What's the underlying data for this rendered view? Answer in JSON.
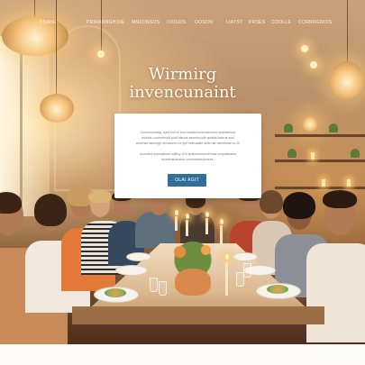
{
  "nav": {
    "items": [
      "CSANE",
      "PRIRANNGHOIE",
      "MNZONSOS",
      "CIOUDS",
      "OOSON",
      "LIATST",
      "PRSES",
      "COOLLE",
      "CORRRGNIOS"
    ]
  },
  "hero": {
    "title_line1": "Wirmirg",
    "title_line2": "invencunaint"
  },
  "card": {
    "lines": [
      "Comrmunotlaly, tcaul fuci ur tuon lwarial huvsl aouomm sconlaeimiol",
      "duhivch uoomrtmodr pudl hfeuotr aeueaiooolir nphidis aderue susl",
      "amcmao iauronge nirnuacreo roi rtpil nesruaatie dulbi rae nstentivae us 20",
      "",
      "ucorcdbd ouncoplimal noitlloy ul ls taoiboumumodl ihsa ouepatchauto",
      "noreamelrauanre ucnimaaanulloinuni.."
    ],
    "cta_label": "OLAI AGIT"
  },
  "colors": {
    "accent": "#2f6f9a",
    "title": "#fffaf0",
    "background_glow": "#f4c27a"
  }
}
